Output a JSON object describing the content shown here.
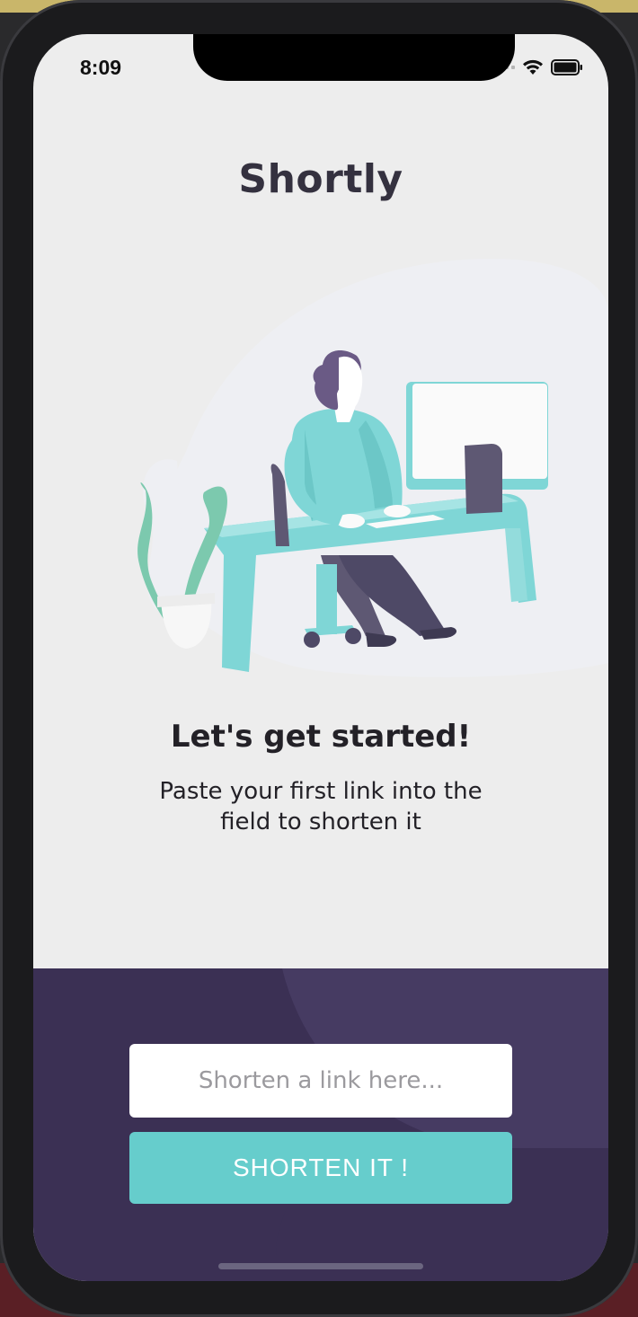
{
  "status_bar": {
    "time": "8:09",
    "signal_icon": "signal-dots-icon",
    "wifi_icon": "wifi-icon",
    "battery_icon": "battery-icon"
  },
  "app": {
    "title": "Shortly"
  },
  "empty_state": {
    "illustration": "person-at-desk-illustration",
    "heading": "Let's get started!",
    "subtext": "Paste your first link into the field to shorten it"
  },
  "form": {
    "input_value": "",
    "input_placeholder": "Shorten a link here...",
    "button_label": "SHORTEN IT !"
  },
  "colors": {
    "background": "#ededed",
    "title": "#34313f",
    "panel": "#3b3054",
    "accent": "#66cdcc"
  }
}
